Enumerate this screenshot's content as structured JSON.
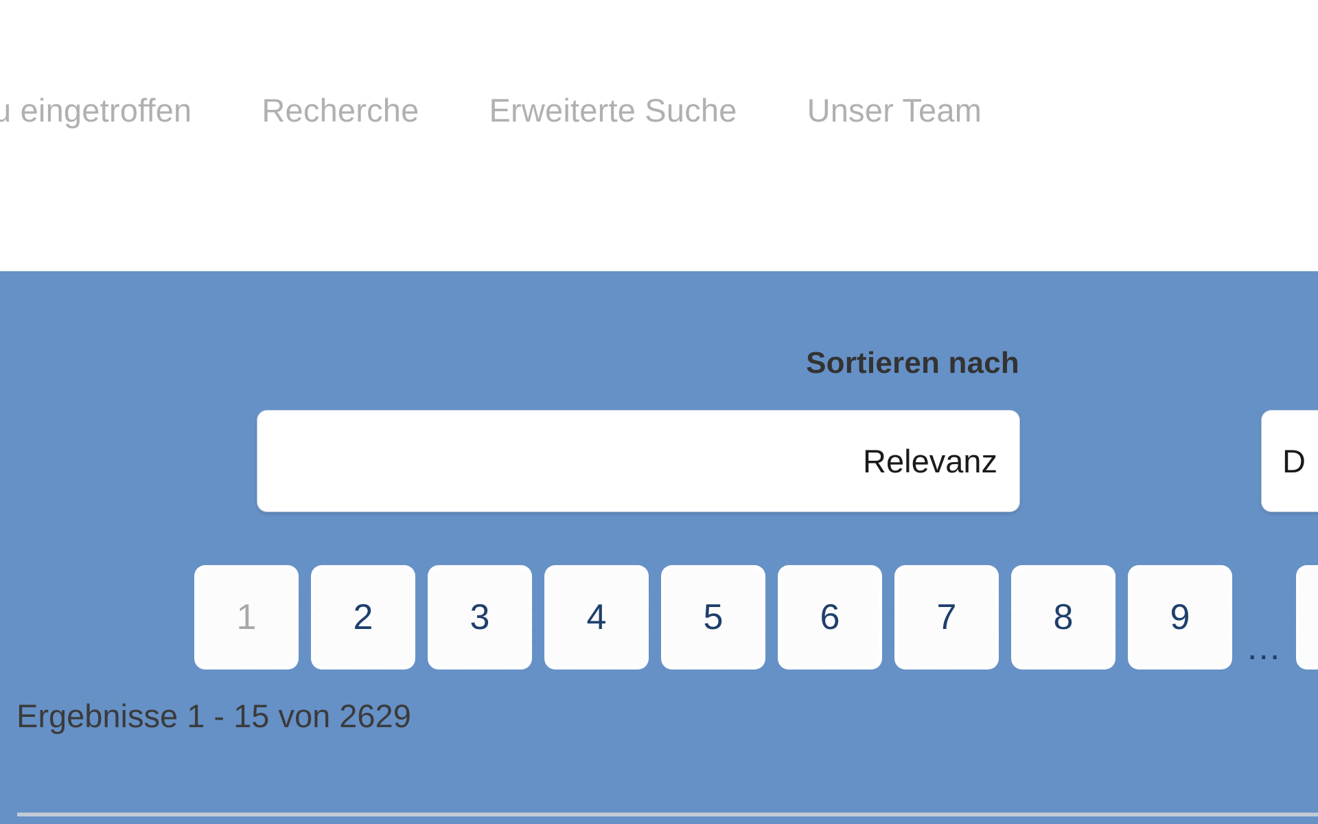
{
  "nav": {
    "items": [
      {
        "label": "u eingetroffen",
        "name": "nav-item-neu-eingetroffen"
      },
      {
        "label": "Recherche",
        "name": "nav-item-recherche"
      },
      {
        "label": "Erweiterte Suche",
        "name": "nav-item-erweiterte-suche"
      },
      {
        "label": "Unser Team",
        "name": "nav-item-unser-team"
      }
    ]
  },
  "toolbar": {
    "sort_label": "Sortieren nach",
    "sort_select": {
      "value": "Relevanz",
      "options": [
        "Relevanz"
      ]
    },
    "date_select": {
      "value": "D",
      "options": [
        "D"
      ]
    },
    "results_count": "Ergebnisse 1 - 15 von 2629"
  },
  "pagination": {
    "current_page": "1",
    "ellipsis": "...",
    "pages": [
      {
        "label": "1",
        "current": true
      },
      {
        "label": "2",
        "current": false
      },
      {
        "label": "3",
        "current": false
      },
      {
        "label": "4",
        "current": false
      },
      {
        "label": "5",
        "current": false
      },
      {
        "label": "6",
        "current": false
      },
      {
        "label": "7",
        "current": false
      },
      {
        "label": "8",
        "current": false
      },
      {
        "label": "9",
        "current": false
      }
    ],
    "trailing_page": {
      "label": "",
      "current": false
    }
  },
  "colors": {
    "toolbar_blue": "#6691c7",
    "nav_text_grey": "#b0b0b0",
    "page_number_navy": "#1f3f6b",
    "page_current_grey": "#a8a8a8",
    "body_text_dark": "#3b3b3b"
  }
}
